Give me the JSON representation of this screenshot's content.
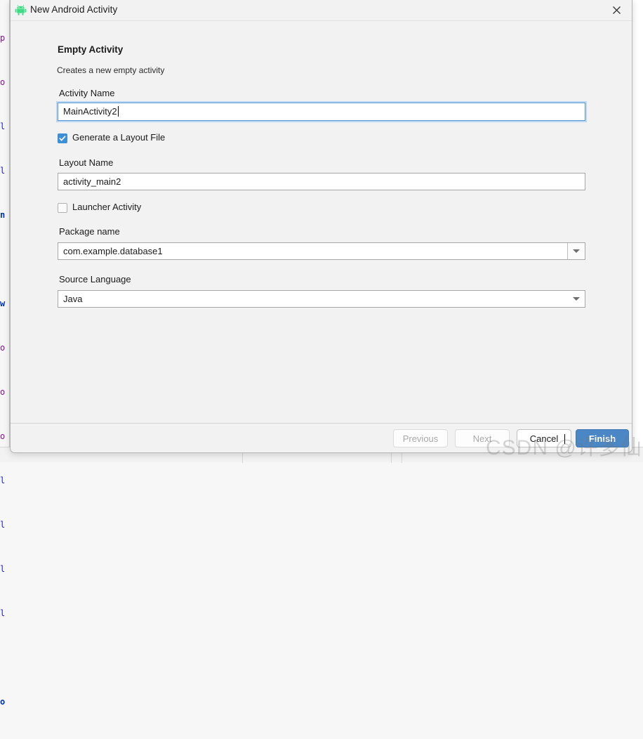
{
  "window": {
    "title": "New Android Activity",
    "icon": "android-robot-icon",
    "close_icon": "close-icon"
  },
  "wizard": {
    "heading": "Empty Activity",
    "description": "Creates a new empty activity"
  },
  "fields": {
    "activity_name": {
      "label": "Activity Name",
      "value": "MainActivity2",
      "focused": true
    },
    "generate_layout": {
      "label": "Generate a Layout File",
      "checked": true
    },
    "layout_name": {
      "label": "Layout Name",
      "value": "activity_main2",
      "focused": false
    },
    "launcher_activity": {
      "label": "Launcher Activity",
      "checked": false
    },
    "package_name": {
      "label": "Package name",
      "value": "com.example.database1",
      "dropdown_icon": "chevron-down-icon"
    },
    "source_language": {
      "label": "Source Language",
      "value": "Java",
      "dropdown_icon": "chevron-down-icon"
    }
  },
  "footer": {
    "previous_label": "Previous",
    "next_label": "Next",
    "cancel_label": "Cancel",
    "finish_label": "Finish"
  },
  "watermark": {
    "text": "CSDN @许多仙"
  },
  "background": {
    "code_fragment": "p\no\nl\nl\nn\n\nw\no\no\no\nl\nl\nl\nl\n\no"
  },
  "colors": {
    "accent": "#4a87c4",
    "checkbox": "#3d8fd6",
    "focus_border": "#5b9bd5",
    "focus_glow": "#b9d7f2",
    "dialog_bg": "#f2f2f2",
    "android_green": "#3ddc84"
  }
}
